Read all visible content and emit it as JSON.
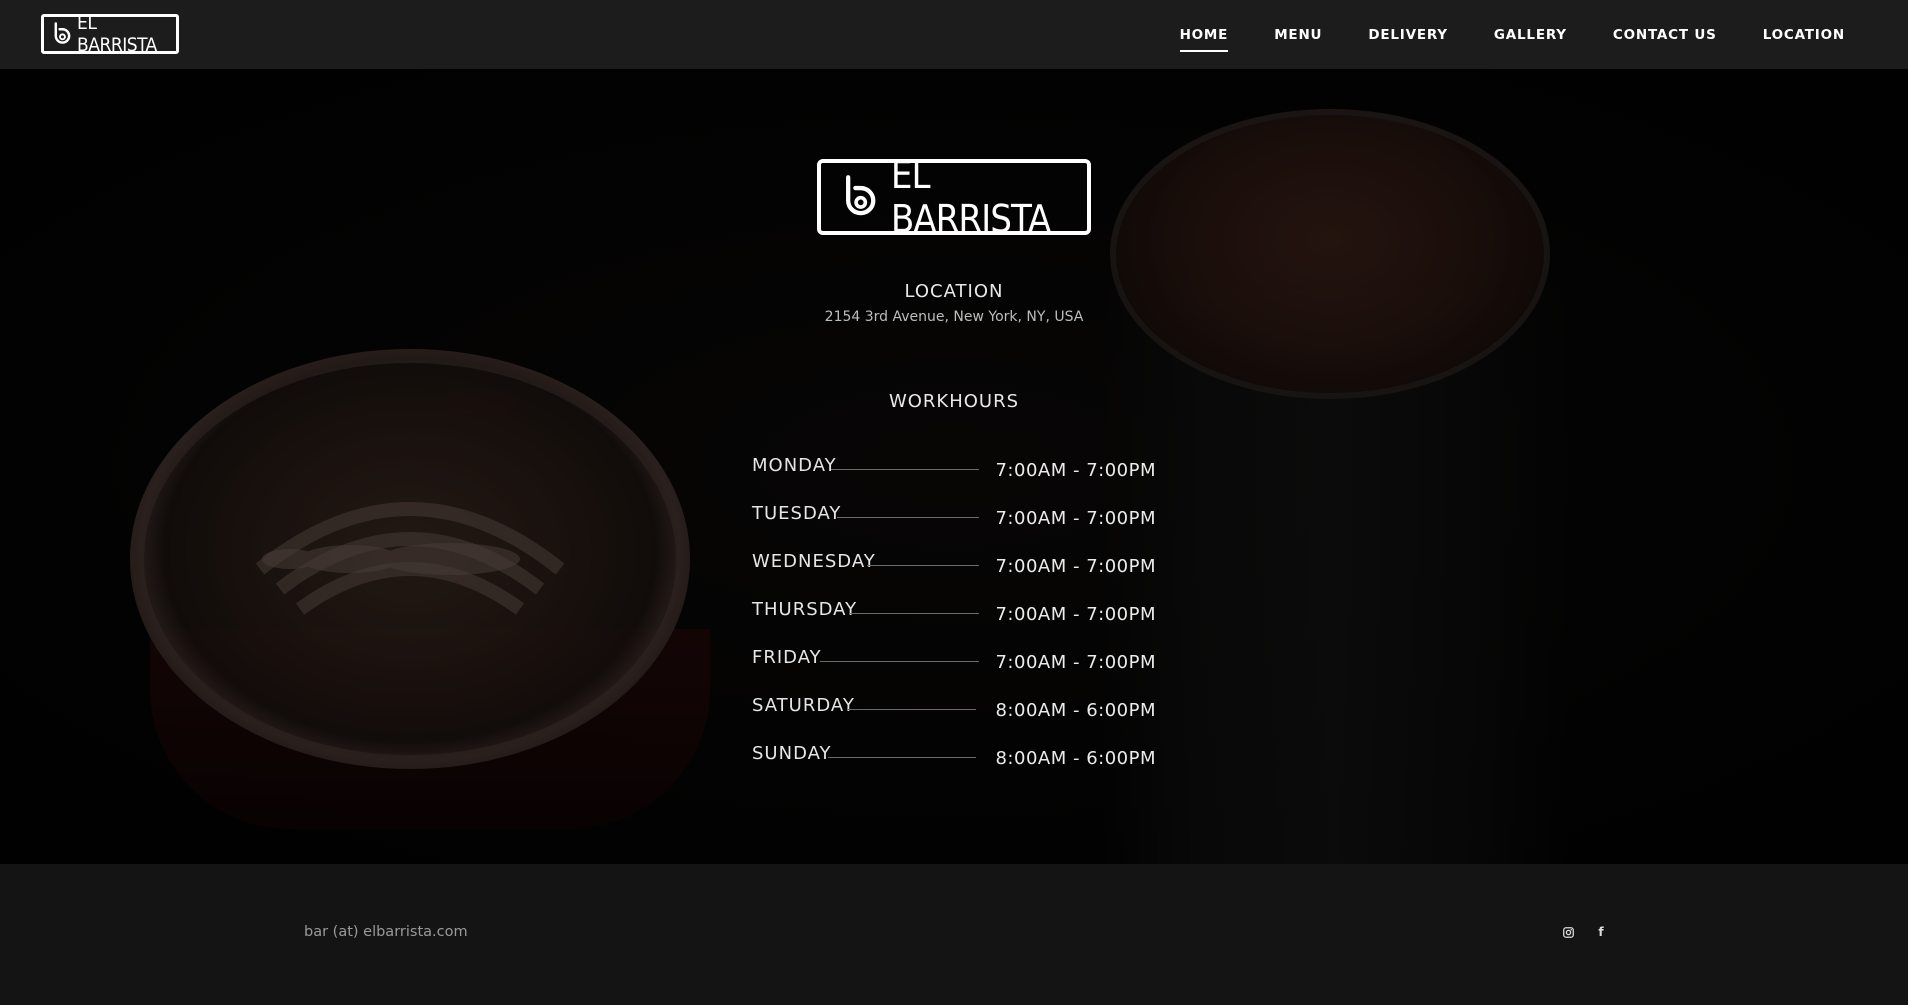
{
  "brand": {
    "name": "EL BARRISTA"
  },
  "nav": {
    "items": [
      {
        "label": "HOME",
        "active": true
      },
      {
        "label": "MENU",
        "active": false
      },
      {
        "label": "DELIVERY",
        "active": false
      },
      {
        "label": "GALLERY",
        "active": false
      },
      {
        "label": "CONTACT US",
        "active": false
      },
      {
        "label": "LOCATION",
        "active": false
      }
    ]
  },
  "location": {
    "title": "LOCATION",
    "address": "2154 3rd Avenue, New York, NY, USA"
  },
  "workhours": {
    "title": "WORKHOURS",
    "rows": [
      {
        "day": "MONDAY",
        "time": "7:00AM - 7:00PM"
      },
      {
        "day": "TUESDAY",
        "time": "7:00AM - 7:00PM"
      },
      {
        "day": "WEDNESDAY",
        "time": "7:00AM - 7:00PM"
      },
      {
        "day": "THURSDAY",
        "time": "7:00AM - 7:00PM"
      },
      {
        "day": "FRIDAY",
        "time": "7:00AM - 7:00PM"
      },
      {
        "day": "SATURDAY",
        "time": "8:00AM - 6:00PM"
      },
      {
        "day": "SUNDAY",
        "time": "8:00AM - 6:00PM"
      }
    ]
  },
  "footer": {
    "email": "bar (at) elbarrista.com",
    "social": [
      {
        "icon": "instagram-icon"
      },
      {
        "icon": "facebook-icon",
        "glyph": "f"
      }
    ]
  }
}
